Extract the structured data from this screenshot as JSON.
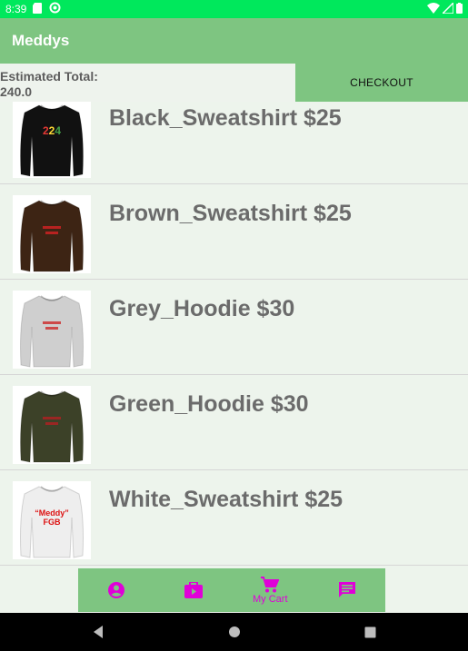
{
  "status_bar": {
    "time": "8:39"
  },
  "app": {
    "title": "Meddys"
  },
  "summary": {
    "total_label": "Estimated Total:",
    "total_value": "240.0",
    "checkout_label": "CHECKOUT"
  },
  "products": [
    {
      "label": "Black_Sweatshirt $25",
      "shirt_color": "#111111",
      "print": "224",
      "print_color": "multi"
    },
    {
      "label": "Brown_Sweatshirt $25",
      "shirt_color": "#3d2414",
      "print": "",
      "print_color": "#cc2222"
    },
    {
      "label": "Grey_Hoodie $30",
      "shirt_color": "#cfcfcf",
      "print": "",
      "print_color": "#cc3333"
    },
    {
      "label": "Green_Hoodie $30",
      "shirt_color": "#3c4128",
      "print": "",
      "print_color": "#aa2222"
    },
    {
      "label": "White_Sweatshirt $25",
      "shirt_color": "#eeeeee",
      "print": "\"Meddy\" FGB",
      "print_color": "#dd1111"
    }
  ],
  "bottom_nav": {
    "items": [
      {
        "icon": "account-icon",
        "label": ""
      },
      {
        "icon": "shop-icon",
        "label": ""
      },
      {
        "icon": "cart-icon",
        "label": "My Cart"
      },
      {
        "icon": "message-icon",
        "label": ""
      }
    ]
  },
  "colors": {
    "status_bar": "#00e85c",
    "app_bar": "#7ec581",
    "accent": "#e000d8",
    "background": "#edf4ec"
  }
}
